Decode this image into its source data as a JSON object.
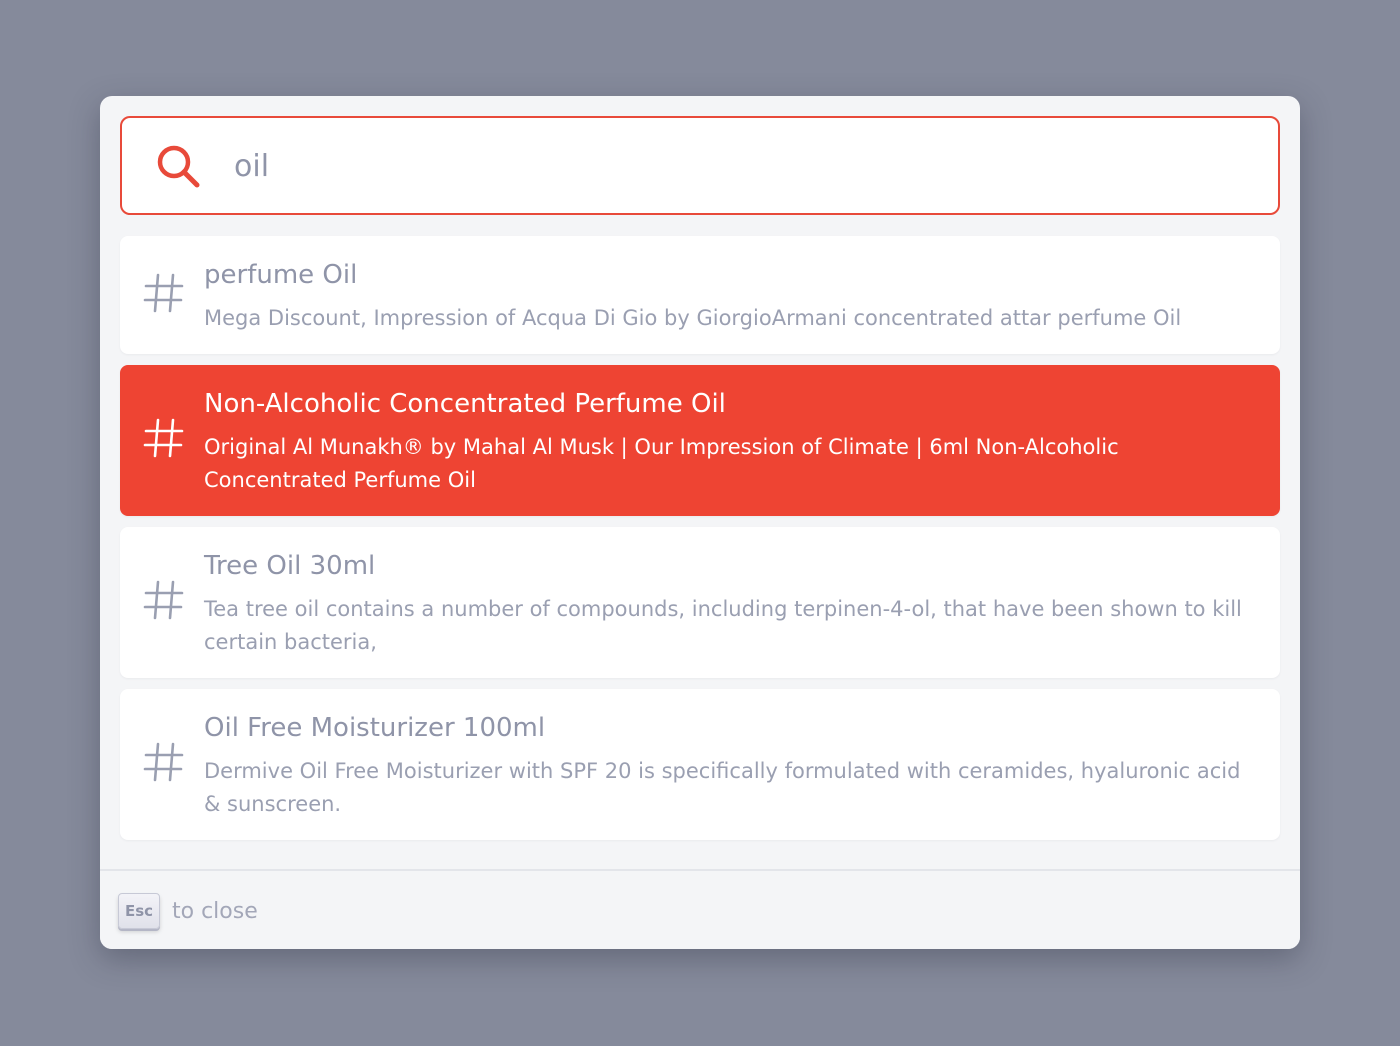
{
  "search": {
    "value": "oil",
    "accent_color": "#e84a3a"
  },
  "results": [
    {
      "icon": "hash-icon",
      "title": "perfume Oil",
      "description": "Mega Discount, Impression of Acqua Di Gio by GiorgioArmani concentrated attar perfume Oil",
      "selected": false
    },
    {
      "icon": "hash-icon",
      "title": "Non-Alcoholic Concentrated Perfume Oil",
      "description": "Original Al Munakh® by Mahal Al Musk | Our Impression of Climate | 6ml Non-Alcoholic Concentrated Perfume Oil",
      "selected": true,
      "highlight_color": "#ee4433"
    },
    {
      "icon": "hash-icon",
      "title": "Tree Oil 30ml",
      "description": "Tea tree oil contains a number of compounds, including terpinen-4-ol, that have been shown to kill certain bacteria,",
      "selected": false
    },
    {
      "icon": "hash-icon",
      "title": "Oil Free Moisturizer 100ml",
      "description": "Dermive Oil Free Moisturizer with SPF 20 is specifically formulated with ceramides, hyaluronic acid & sunscreen.",
      "selected": false
    }
  ],
  "footer": {
    "key_label": "Esc",
    "hint": "to close"
  }
}
